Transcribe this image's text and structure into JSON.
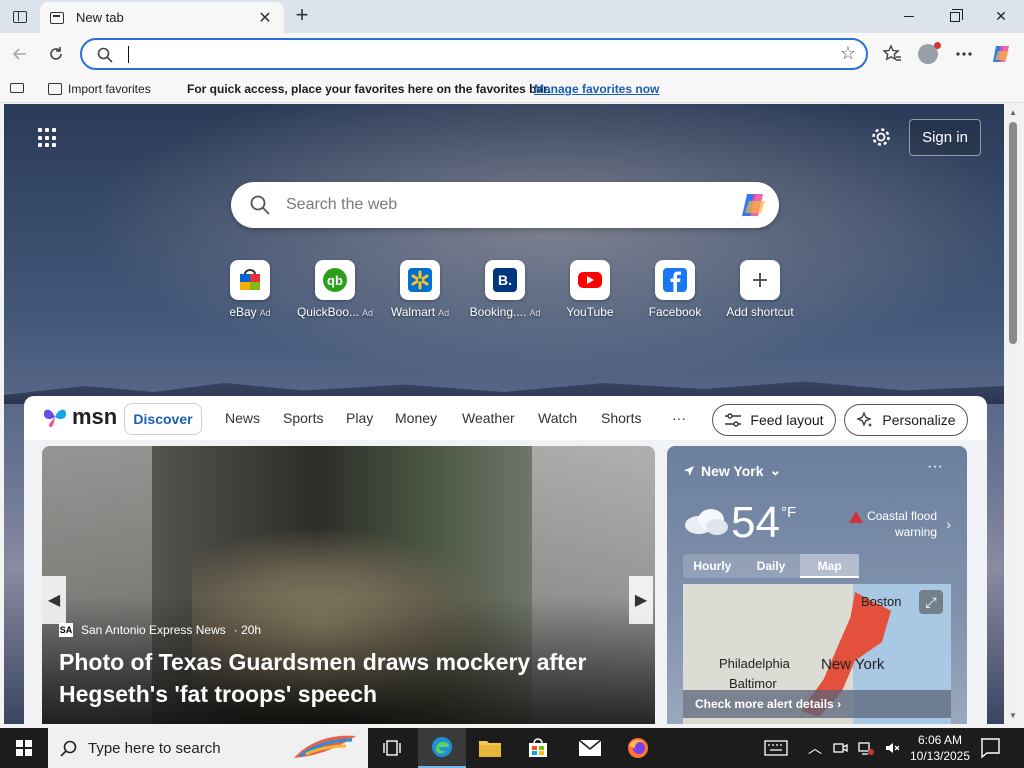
{
  "browser": {
    "tab_title": "New tab",
    "new_tab_symbol": "+",
    "address_value": ""
  },
  "favbar": {
    "import_label": "Import favorites",
    "hint": "For quick access, place your favorites here on the favorites bar.",
    "manage_link": "Manage favorites now"
  },
  "newtab": {
    "sign_in": "Sign in",
    "search_placeholder": "Search the web",
    "shortcuts": [
      {
        "label": "eBay",
        "ad": "Ad",
        "icon": "ebay-icon",
        "color": "#e53238"
      },
      {
        "label": "QuickBoo...",
        "ad": "Ad",
        "icon": "quickbooks-icon",
        "color": "#2ca01c"
      },
      {
        "label": "Walmart",
        "ad": "Ad",
        "icon": "walmart-icon",
        "color": "#0071ce"
      },
      {
        "label": "Booking....",
        "ad": "Ad",
        "icon": "booking-icon",
        "color": "#003580"
      },
      {
        "label": "YouTube",
        "ad": "",
        "icon": "youtube-icon",
        "color": "#ff0000"
      },
      {
        "label": "Facebook",
        "ad": "",
        "icon": "facebook-icon",
        "color": "#1877f2"
      },
      {
        "label": "Add shortcut",
        "ad": "",
        "icon": "plus-icon",
        "color": "#444444"
      }
    ]
  },
  "msn": {
    "logo": "msn",
    "nav": [
      "Discover",
      "News",
      "Sports",
      "Play",
      "Money",
      "Weather",
      "Watch",
      "Shorts"
    ],
    "more": "···",
    "feed_layout": "Feed layout",
    "personalize": "Personalize"
  },
  "news": {
    "source": "San Antonio Express News",
    "age": "· 20h",
    "headline": "Photo of Texas Guardsmen draws mockery after Hegseth's 'fat troops' speech"
  },
  "weather": {
    "location": "New York",
    "temp": "54",
    "unit": "°F",
    "alert": "Coastal flood warning",
    "tabs": [
      "Hourly",
      "Daily",
      "Map"
    ],
    "selected_tab": "Map",
    "map_labels": {
      "boston": "Boston",
      "philadelphia": "Philadelphia",
      "newyork": "New York",
      "baltimore": "Baltimor"
    },
    "check_alerts": "Check more alert details"
  },
  "taskbar": {
    "search_placeholder": "Type here to search",
    "time": "6:06 AM",
    "date": "10/13/2025"
  }
}
